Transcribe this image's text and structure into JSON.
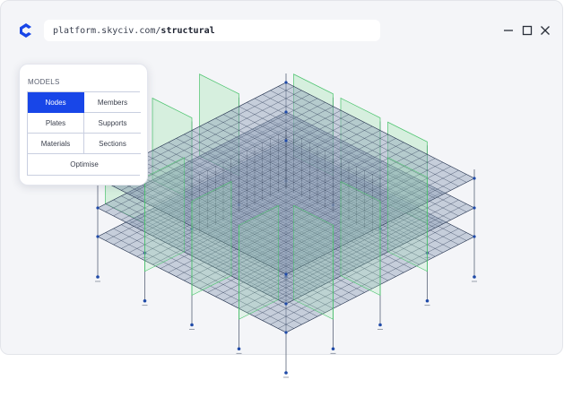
{
  "browser": {
    "url_prefix": "platform.skyciv.com/",
    "url_path": "structural"
  },
  "window_controls": [
    "minimize-icon",
    "maximize-icon",
    "close-icon"
  ],
  "panel": {
    "title": "MODELS",
    "items": [
      {
        "label": "Nodes",
        "active": true
      },
      {
        "label": "Members",
        "active": false
      },
      {
        "label": "Plates",
        "active": false
      },
      {
        "label": "Supports",
        "active": false
      },
      {
        "label": "Materials",
        "active": false
      },
      {
        "label": "Sections",
        "active": false
      }
    ],
    "optimise_label": "Optimise"
  },
  "colors": {
    "accent": "#1846e8",
    "grid_line": "#2c3a55",
    "plate_fill": "#8fa0b8",
    "wall_fill": "#9ee6b0",
    "node": "#1f4aa8"
  }
}
